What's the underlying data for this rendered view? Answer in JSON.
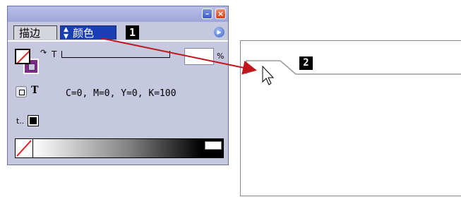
{
  "panel": {
    "tabs": [
      {
        "label": "描边",
        "active": false
      },
      {
        "label": "颜色",
        "active": true
      }
    ],
    "callout_1": "1",
    "tint": {
      "label": "T",
      "unit": "%",
      "value": ""
    },
    "cmyk_readout": "C=0, M=0, Y=0, K=100",
    "text_format_label": "T"
  },
  "callout_2": "2",
  "colors": {
    "panel_bg": "#c5c8de",
    "active_tab": "#1a3fb4",
    "fill_swatch": "#802a8a",
    "arrow": "#c0161c"
  },
  "icons": [
    "minimize-icon",
    "close-icon",
    "panel-menu-icon",
    "swap-fill-stroke-icon",
    "format-container-icon",
    "format-text-icon",
    "tint-icon",
    "black-swatch-icon",
    "none-swatch-icon",
    "mouse-pointer-icon"
  ]
}
